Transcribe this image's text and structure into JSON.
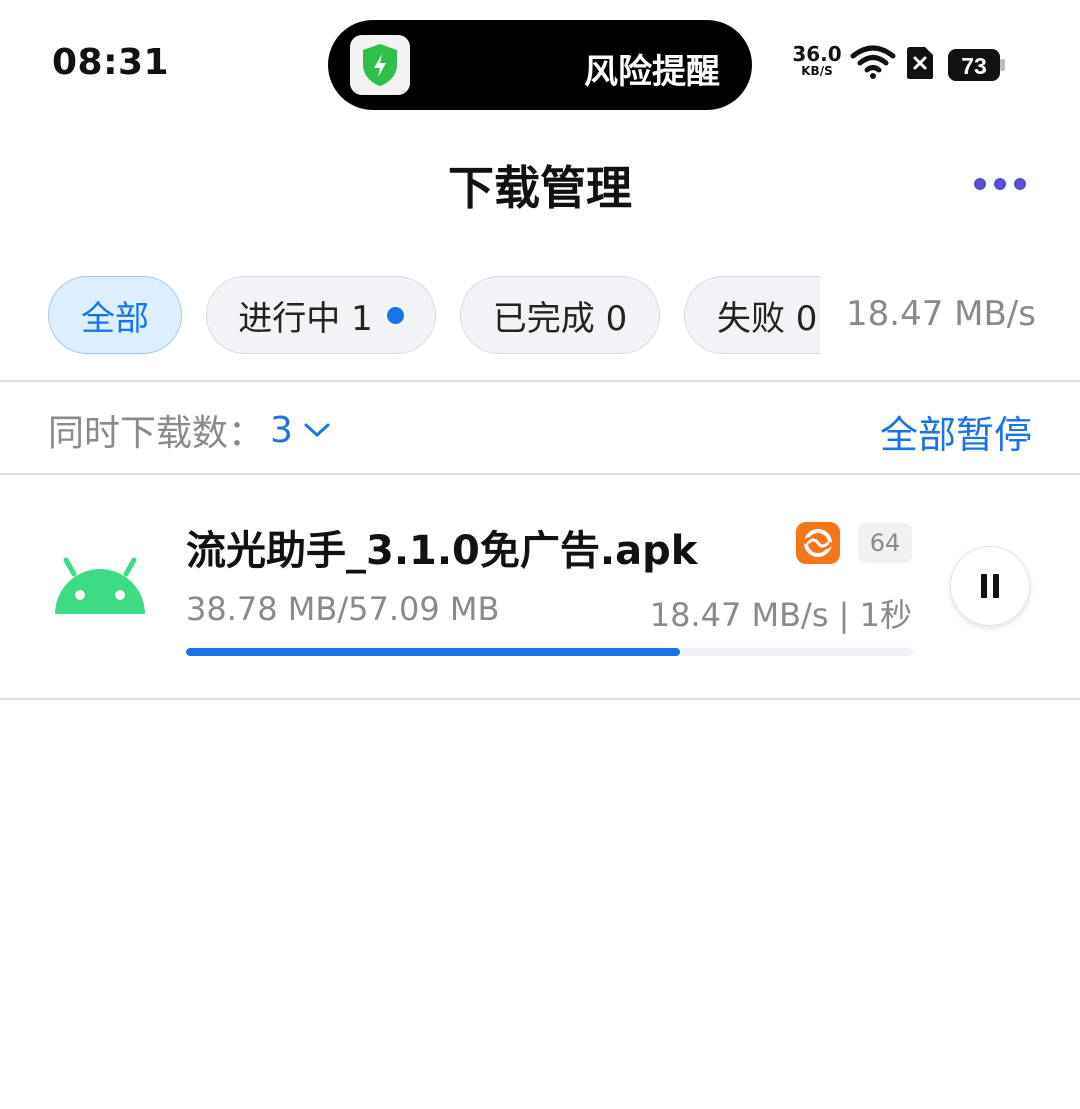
{
  "status_bar": {
    "time": "08:31",
    "island_text": "风险提醒",
    "net_speed_value": "36.0",
    "net_speed_unit": "KB/S",
    "battery": "73",
    "icons": [
      "shield-bolt-icon",
      "wifi-icon",
      "sim-absent-icon",
      "battery-icon"
    ]
  },
  "header": {
    "title": "下载管理",
    "more_icon": "more-dots-icon",
    "accent_color": "#5a4fd0"
  },
  "filters": {
    "chips": [
      {
        "label": "全部",
        "active": true
      },
      {
        "label": "进行中 1",
        "active": false,
        "indicator": "blue-dot"
      },
      {
        "label": "已完成 0",
        "active": false
      },
      {
        "label": "失败 0",
        "active": false
      }
    ],
    "total_speed": "18.47 MB/s"
  },
  "concurrency": {
    "label": "同时下载数：",
    "value": "3",
    "pause_all_label": "全部暂停"
  },
  "downloads": [
    {
      "file_name": "流光助手_3.1.0免广告.apk",
      "icon": "android-icon",
      "brand_badge_icon": "brand-logo-icon",
      "bit_badge": "64",
      "size_text": "38.78 MB/57.09 MB",
      "rate_text": "18.47 MB/s | 1秒",
      "progress": 0.679,
      "action_icon": "pause-icon"
    }
  ],
  "colors": {
    "primary": "#1a73e8",
    "android_green": "#3ddc84",
    "brand_orange": "#f5761a"
  }
}
